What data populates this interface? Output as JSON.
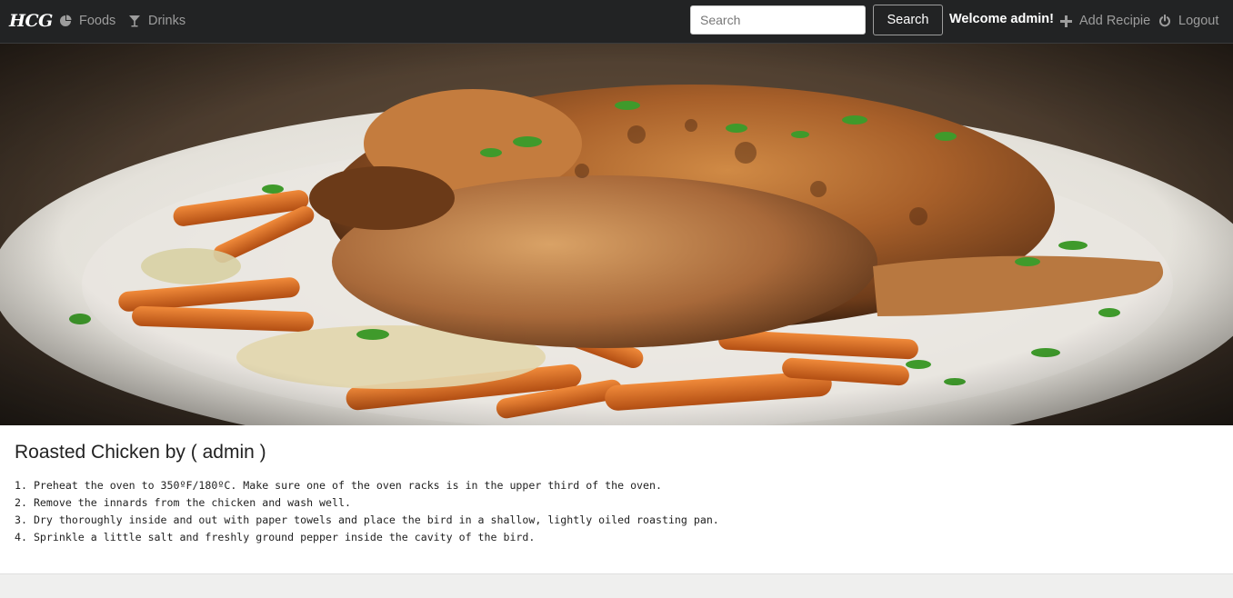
{
  "navbar": {
    "brand": "HCG",
    "links": [
      {
        "label": "Foods",
        "icon": "pie-chart-icon"
      },
      {
        "label": "Drinks",
        "icon": "cocktail-glass-icon"
      }
    ],
    "search": {
      "placeholder": "Search",
      "button_label": "Search"
    },
    "welcome": "Welcome admin!",
    "add_recipe": {
      "label": "Add Recipie",
      "icon": "plus-icon"
    },
    "logout": {
      "label": "Logout",
      "icon": "power-icon"
    }
  },
  "hero": {
    "image": "roasted-chicken-on-plate-photo"
  },
  "recipe": {
    "title": "Roasted Chicken by ( admin )",
    "steps": [
      "1. Preheat the oven to 350ºF/180ºC. Make sure one of the oven racks is in the upper third of the oven.",
      "2. Remove the innards from the chicken and wash well.",
      "3. Dry thoroughly inside and out with paper towels and place the bird in a shallow, lightly oiled roasting pan.",
      "4. Sprinkle a little salt and freshly ground pepper inside the cavity of the bird."
    ]
  },
  "colors": {
    "navbar_bg": "#222324",
    "nav_link": "#9d9d9d",
    "accent_white": "#ffffff"
  }
}
